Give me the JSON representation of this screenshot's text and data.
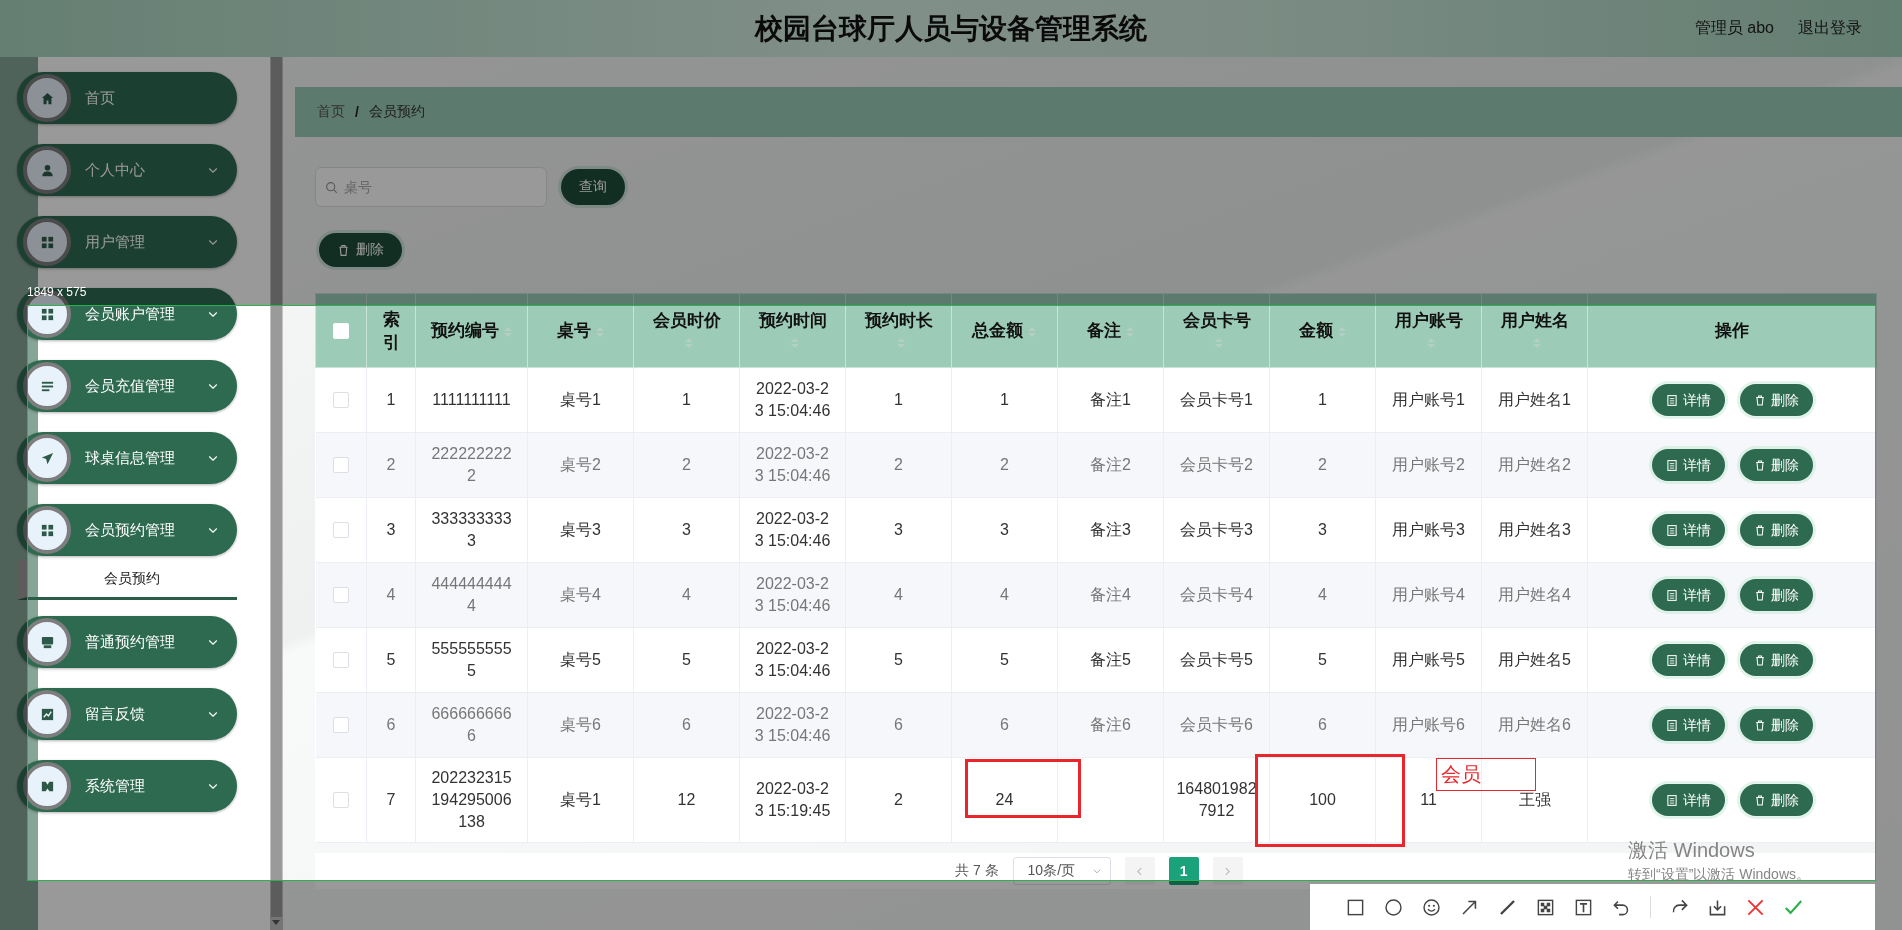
{
  "header": {
    "title": "校园台球厅人员与设备管理系统",
    "user": "管理员 abo",
    "logout": "退出登录"
  },
  "sidebar": {
    "items": [
      {
        "label": "首页",
        "kind": "link"
      },
      {
        "label": "个人中心",
        "kind": "submenu"
      },
      {
        "label": "用户管理",
        "kind": "submenu"
      },
      {
        "label": "会员账户管理",
        "kind": "submenu"
      },
      {
        "label": "会员充值管理",
        "kind": "submenu"
      },
      {
        "label": "球桌信息管理",
        "kind": "submenu"
      },
      {
        "label": "会员预约管理",
        "kind": "submenu",
        "children": [
          {
            "label": "会员预约",
            "selected": true
          }
        ]
      },
      {
        "label": "普通预约管理",
        "kind": "submenu"
      },
      {
        "label": "留言反馈",
        "kind": "submenu"
      },
      {
        "label": "系统管理",
        "kind": "submenu"
      }
    ]
  },
  "breadcrumb": {
    "separator": "/",
    "items": [
      "首页",
      "会员预约"
    ]
  },
  "search": {
    "placeholder": "桌号",
    "button": "查询"
  },
  "toolbar": {
    "delete_button": "删除"
  },
  "table": {
    "select_all_checked": false,
    "columns": [
      {
        "label": "索引",
        "sortable": false
      },
      {
        "label": "预约编号",
        "sortable": true
      },
      {
        "label": "桌号",
        "sortable": true
      },
      {
        "label": "会员时价",
        "sortable": true
      },
      {
        "label": "预约时间",
        "sortable": true
      },
      {
        "label": "预约时长",
        "sortable": true
      },
      {
        "label": "总金额",
        "sortable": true
      },
      {
        "label": "备注",
        "sortable": true
      },
      {
        "label": "会员卡号",
        "sortable": true
      },
      {
        "label": "金额",
        "sortable": true
      },
      {
        "label": "用户账号",
        "sortable": true
      },
      {
        "label": "用户姓名",
        "sortable": true
      },
      {
        "label": "操作",
        "sortable": false
      }
    ],
    "rows": [
      {
        "checked": false,
        "cells": [
          "1",
          "1111111111",
          "桌号1",
          "1",
          "2022-03-23 15:04:46",
          "1",
          "1",
          "备注1",
          "会员卡号1",
          "1",
          "用户账号1",
          "用户姓名1"
        ],
        "actions": [
          "详情",
          "删除"
        ]
      },
      {
        "checked": false,
        "cells": [
          "2",
          "2222222222",
          "桌号2",
          "2",
          "2022-03-23 15:04:46",
          "2",
          "2",
          "备注2",
          "会员卡号2",
          "2",
          "用户账号2",
          "用户姓名2"
        ],
        "actions": [
          "详情",
          "删除"
        ]
      },
      {
        "checked": false,
        "cells": [
          "3",
          "3333333333",
          "桌号3",
          "3",
          "2022-03-23 15:04:46",
          "3",
          "3",
          "备注3",
          "会员卡号3",
          "3",
          "用户账号3",
          "用户姓名3"
        ],
        "actions": [
          "详情",
          "删除"
        ]
      },
      {
        "checked": false,
        "cells": [
          "4",
          "4444444444",
          "桌号4",
          "4",
          "2022-03-23 15:04:46",
          "4",
          "4",
          "备注4",
          "会员卡号4",
          "4",
          "用户账号4",
          "用户姓名4"
        ],
        "actions": [
          "详情",
          "删除"
        ]
      },
      {
        "checked": false,
        "cells": [
          "5",
          "5555555555",
          "桌号5",
          "5",
          "2022-03-23 15:04:46",
          "5",
          "5",
          "备注5",
          "会员卡号5",
          "5",
          "用户账号5",
          "用户姓名5"
        ],
        "actions": [
          "详情",
          "删除"
        ]
      },
      {
        "checked": false,
        "cells": [
          "6",
          "6666666666",
          "桌号6",
          "6",
          "2022-03-23 15:04:46",
          "6",
          "6",
          "备注6",
          "会员卡号6",
          "6",
          "用户账号6",
          "用户姓名6"
        ],
        "actions": [
          "详情",
          "删除"
        ]
      },
      {
        "checked": false,
        "cells": [
          "7",
          "202232315194295006138",
          "桌号1",
          "12",
          "2022-03-23 15:19:45",
          "2",
          "24",
          "",
          "1648019827912",
          "100",
          "11",
          "王强"
        ],
        "actions": [
          "详情",
          "删除"
        ]
      }
    ]
  },
  "pagination": {
    "total": "共 7 条",
    "page_size": "10条/页",
    "pages": [
      {
        "label": "1",
        "selected": true
      }
    ]
  },
  "screenshot_tool": {
    "size_label": "1849 x 575",
    "annotations": [
      {
        "kind": "rect"
      },
      {
        "kind": "rect"
      },
      {
        "kind": "text",
        "text": "会员"
      }
    ]
  },
  "activation_notice": [
    "激活 Windows",
    "转到“设置”以激活 Windows。"
  ]
}
